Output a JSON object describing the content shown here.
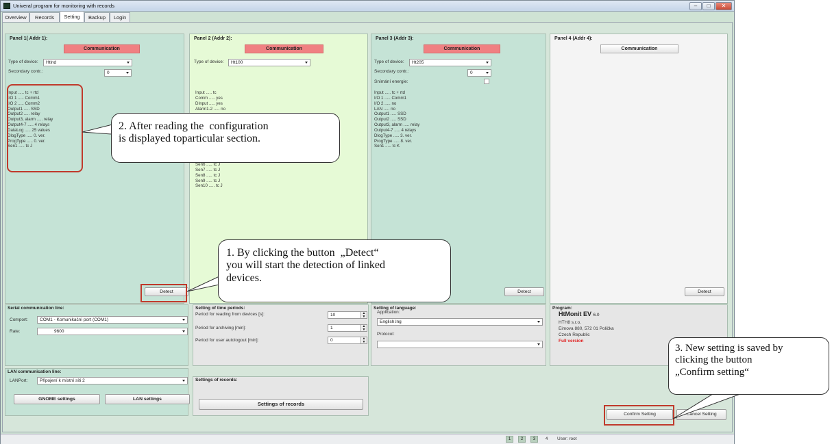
{
  "window": {
    "title": "Univeral program for monitoring with records",
    "buttons": [
      "–",
      "□",
      "✕"
    ]
  },
  "tabs": [
    {
      "label": "Overview"
    },
    {
      "label": "Records"
    },
    {
      "label": "Setting"
    },
    {
      "label": "Backup"
    },
    {
      "label": "Login"
    }
  ],
  "active_tab": "Setting",
  "panels": [
    {
      "title": "Panel 1( Addr 1):",
      "comm_label": "Communication",
      "device_label": "Type of device:",
      "device_value": "Htlnd",
      "secondary_label": "Secondary contr.:",
      "secondary_value": "0",
      "info": [
        "Input ..... tc + rtd",
        "I/O 1 ..... Comm1",
        "I/O 2 ..... Comm2",
        "Output1 ..... SSD",
        "Output2 ..... relay",
        "Output3, alarm ..... relay",
        "Output4-7 ..... 4 relays",
        "DataLog ..... 25 values",
        "DlogType ..... 0. ver.",
        "ProgType ..... 0. ver.",
        "Sen1 ..... tc J"
      ],
      "detect_label": "Detect"
    },
    {
      "title": "Panel 2 (Addr 2):",
      "comm_label": "Communication",
      "device_label": "Type of device:",
      "device_value": "Ht100",
      "info_top": [
        "Input ..... tc",
        "Comm ..... yes",
        "DInput ..... yes",
        "Alarm1-2 ..... no"
      ],
      "info_bottom": [
        "Sen6 ..... tc J",
        "Sen7 ..... tc J",
        "Sen8 ..... tc J",
        "Sen9 ..... tc J",
        "Sen10 ..... tc J"
      ]
    },
    {
      "title": "Panel 3 (Addr 3):",
      "comm_label": "Communication",
      "device_label": "Type of device:",
      "device_value": "Ht205",
      "secondary_label": "Secondary contr.:",
      "secondary_value": "0",
      "energy_label": "Snímání energie:",
      "info": [
        "Input ..... tc + rtd",
        "I/O 1 ..... Comm1",
        "I/O 2 ..... no",
        "LAN ..... no",
        "Output1 ..... SSD",
        "Output2 ..... SSD",
        "Output3, alarm ..... relay",
        "Output4-7 ..... 4 relays",
        "DlogType ..... 3. ver.",
        "ProgType ..... 8. ver.",
        "Sen1 ..... tc K"
      ],
      "detect_label": "Detect"
    },
    {
      "title": "Panel 4 (Addr 4):",
      "comm_label": "Communication",
      "detect_label": "Detect"
    }
  ],
  "serial": {
    "title": "Serial communication line:",
    "comport_label": "Comport:",
    "comport_value": "COM1 - Komunikační port (COM1)",
    "rate_label": "Rate:",
    "rate_value": "9600"
  },
  "lan": {
    "title": "LAN communication line:",
    "port_label": "LANPort:",
    "port_value": "Připojení k místní síti 2",
    "gnome_btn": "GNOME settings",
    "lan_btn": "LAN settings"
  },
  "time": {
    "title": "Setting of time periods:",
    "reading_label": "Period for reading from devices [s]:",
    "reading_value": "10",
    "archiving_label": "Period for archiving [min]:",
    "archiving_value": "1",
    "logout_label": "Period for user autologout [min]:",
    "logout_value": "0"
  },
  "records": {
    "title": "Settings of records:",
    "button": "Settings of records"
  },
  "language": {
    "title": "Setting of language:",
    "app_label": "Application:",
    "app_value": "English.lng",
    "protocol_label": "Protocol:",
    "protocol_value": ""
  },
  "program": {
    "title": "Program:",
    "name": "HtMonit EV",
    "version": "6.0",
    "company": "HTH8 s.r.o.",
    "address": "Eimova 880, 572 01 Polička",
    "country": "Czech Republic",
    "license": "Full version"
  },
  "actions": {
    "confirm": "Confirm Setting",
    "cancel": "Cancel Setting"
  },
  "status": {
    "pages": [
      "1",
      "2",
      "3",
      "4"
    ],
    "user": "User: root"
  },
  "callouts": {
    "c1": "1. By clicking the button  „Detect“\nyou will start the detection of linked\ndevices.",
    "c2": "2. After reading the  configuration\nis displayed toparticular section.",
    "c3": "3. New setting is saved by\nclicking the button\n„Confirm setting“"
  },
  "colors": {
    "panel_green": "#c5e3d6",
    "panel_lightgreen": "#e6fad6",
    "comm_red": "#f08082",
    "highlight_red": "#c0392b",
    "full_version": "#e02020"
  }
}
